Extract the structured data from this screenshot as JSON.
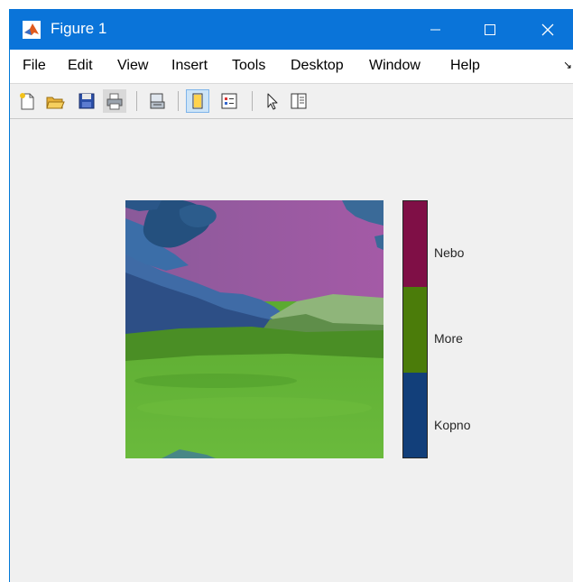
{
  "window": {
    "title": "Figure 1"
  },
  "menu": {
    "items": [
      "File",
      "Edit",
      "View",
      "Insert",
      "Tools",
      "Desktop",
      "Window",
      "Help"
    ],
    "overflow": "↘"
  },
  "toolbar": {
    "buttons": [
      {
        "icon": "new-figure-icon"
      },
      {
        "icon": "open-file-icon"
      },
      {
        "icon": "save-icon"
      },
      {
        "icon": "print-icon"
      },
      {
        "icon": "link-plot-icon"
      },
      {
        "icon": "insert-colorbar-icon",
        "active": true
      },
      {
        "icon": "insert-legend-icon"
      },
      {
        "icon": "edit-plot-arrow-icon"
      },
      {
        "icon": "property-inspector-icon"
      }
    ]
  },
  "colorbar": {
    "labels": [
      "Nebo",
      "More",
      "Kopno"
    ],
    "colors": [
      "#7f0f46",
      "#4b7c0a",
      "#123f7a"
    ]
  },
  "colors": {
    "titlebar": "#0a74d9",
    "accent": "#0078d7"
  }
}
